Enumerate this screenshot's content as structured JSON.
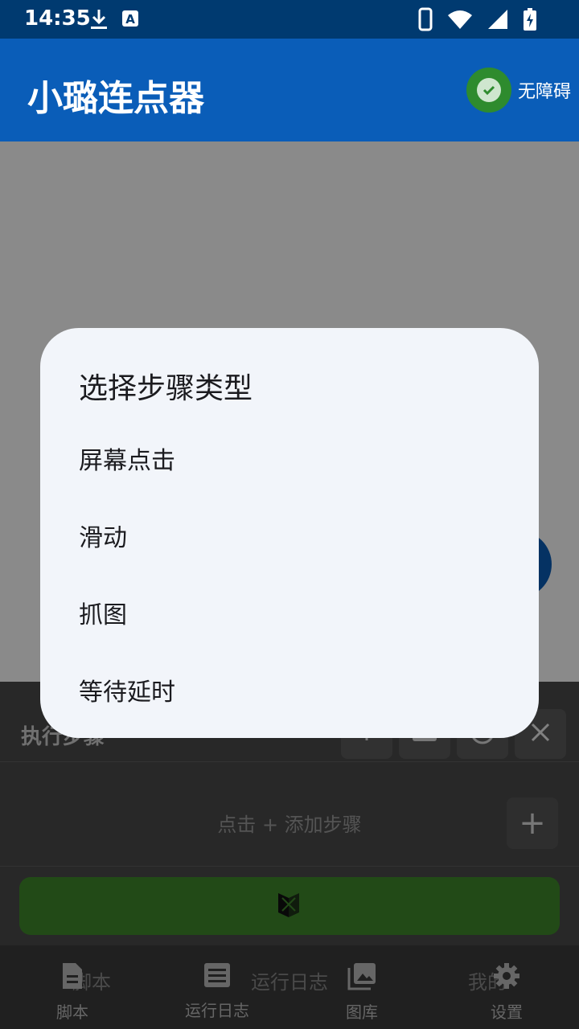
{
  "status_bar": {
    "time": "14:35",
    "icons": [
      "download-icon",
      "text-a-icon",
      "phone-icon",
      "wifi-icon",
      "signal-icon",
      "battery-charging-icon"
    ]
  },
  "app_bar": {
    "title": "小璐连点器",
    "accessibility_label": "无障碍",
    "accessibility_color": "#2e8b2e"
  },
  "panel": {
    "title": "执行步骤",
    "hint": "点击 + 添加步骤",
    "add_symbol": "+",
    "run_color": "#3f8a2c"
  },
  "ghost_nav": [
    "脚本",
    "运行日志",
    "我的"
  ],
  "bottom_nav": [
    {
      "label": "脚本",
      "icon": "script-file-icon"
    },
    {
      "label": "运行日志",
      "icon": "log-list-icon"
    },
    {
      "label": "图库",
      "icon": "gallery-icon"
    },
    {
      "label": "设置",
      "icon": "gear-icon"
    }
  ],
  "dialog": {
    "title": "选择步骤类型",
    "options": [
      "屏幕点击",
      "滑动",
      "抓图",
      "等待延时"
    ]
  }
}
